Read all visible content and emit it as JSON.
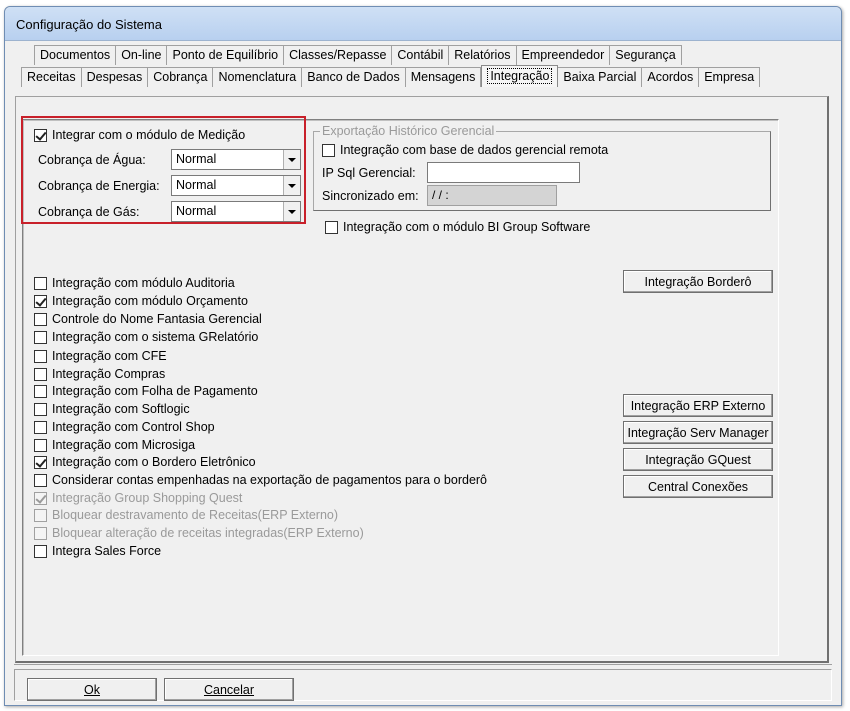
{
  "window": {
    "title": "Configuração do Sistema"
  },
  "tabs_row1": [
    "Documentos",
    "On-line",
    "Ponto de Equilíbrio",
    "Classes/Repasse",
    "Contábil",
    "Relatórios",
    "Empreendedor",
    "Segurança"
  ],
  "tabs_row2": [
    "Receitas",
    "Despesas",
    "Cobrança",
    "Nomenclatura",
    "Banco de Dados",
    "Mensagens",
    "Integração",
    "Baixa Parcial",
    "Acordos",
    "Empresa"
  ],
  "active_tab": "Integração",
  "medicao": {
    "label": "Integrar com o módulo de Medição",
    "checked": true,
    "agua_label": "Cobrança de Água:",
    "agua_value": "Normal",
    "energia_label": "Cobrança de Energia:",
    "energia_value": "Normal",
    "gas_label": "Cobrança de Gás:",
    "gas_value": "Normal"
  },
  "export_group": {
    "legend": "Exportação Histórico Gerencial",
    "remote_label": "Integração com base de dados gerencial remota",
    "remote_checked": false,
    "ip_label": "IP Sql Gerencial:",
    "ip_value": "",
    "sync_label": "Sincronizado em:",
    "sync_value": " /  /       :"
  },
  "bi_label": "Integração com o módulo BI Group Software",
  "options": [
    {
      "label": "Integração com módulo Auditoria",
      "checked": false,
      "disabled": false
    },
    {
      "label": "Integração com módulo Orçamento",
      "checked": true,
      "disabled": false
    },
    {
      "label": "Controle do Nome Fantasia Gerencial",
      "checked": false,
      "disabled": false
    },
    {
      "label": "Integração com o sistema GRelatório",
      "checked": false,
      "disabled": false
    },
    {
      "label": "Integração com CFE",
      "checked": false,
      "disabled": false
    },
    {
      "label": "Integração Compras",
      "checked": false,
      "disabled": false
    },
    {
      "label": "Integração com Folha de Pagamento",
      "checked": false,
      "disabled": false
    },
    {
      "label": "Integração com Softlogic",
      "checked": false,
      "disabled": false
    },
    {
      "label": "Integração com Control Shop",
      "checked": false,
      "disabled": false
    },
    {
      "label": "Integração com Microsiga",
      "checked": false,
      "disabled": false
    },
    {
      "label": "Integração com o Bordero Eletrônico",
      "checked": true,
      "disabled": false
    },
    {
      "label": "Considerar contas empenhadas na exportação de pagamentos para o borderô",
      "checked": false,
      "disabled": false
    },
    {
      "label": "Integração Group Shopping Quest",
      "checked": true,
      "disabled": true
    },
    {
      "label": "Bloquear destravamento de Receitas(ERP Externo)",
      "checked": false,
      "disabled": true
    },
    {
      "label": "Bloquear alteração de receitas integradas(ERP Externo)",
      "checked": false,
      "disabled": true
    },
    {
      "label": "Integra Sales Force",
      "checked": false,
      "disabled": false
    }
  ],
  "buttons": {
    "bordero": "Integração Borderô",
    "erp": "Integração ERP Externo",
    "serv_manager": "Integração Serv Manager",
    "gquest": "Integração GQuest",
    "conexoes": "Central Conexões"
  },
  "footer": {
    "ok": "Ok",
    "cancel": "Cancelar"
  }
}
